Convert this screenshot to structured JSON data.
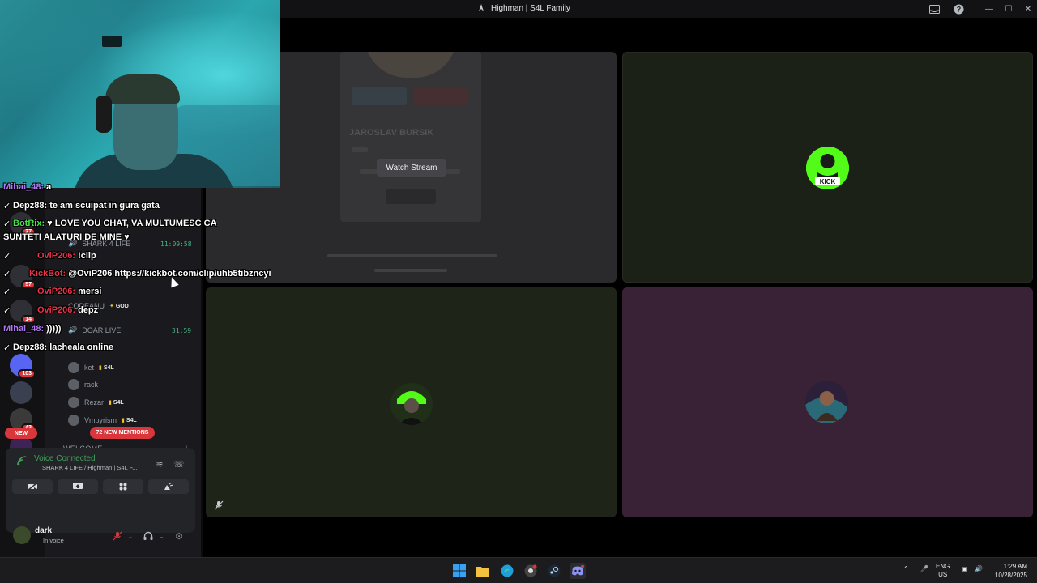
{
  "window": {
    "title": "Highman | S4L Family"
  },
  "stage": {
    "watch_stream": "Watch Stream"
  },
  "screenshare_ghost": {
    "name": "JAROSLAV BURSIK"
  },
  "sidebar": {
    "channels": [
      {
        "name": "SHARK 4 LIFE",
        "time": "11:09:58"
      },
      {
        "name": "DOAR LIVE",
        "time": "31:59"
      }
    ],
    "members": [
      {
        "name": "CODEANU",
        "tag": "GOD"
      },
      {
        "name": "ket",
        "tag": "S4L"
      },
      {
        "name": "rack",
        "tag": ""
      },
      {
        "name": "Rezar",
        "tag": "S4L"
      },
      {
        "name": "Vmpyrism",
        "tag": "S4L"
      }
    ],
    "section_header": "WELCOME",
    "server_badges": [
      "37",
      "57",
      "14",
      "103",
      "43"
    ],
    "new_label": "NEW",
    "mentions_label": "72 NEW MENTIONS"
  },
  "voice": {
    "status": "Voice Connected",
    "channel": "SHARK 4 LIFE / Highman | S4L F...",
    "user": "dark",
    "user_status": "In voice"
  },
  "chat": [
    {
      "user": "Mihai_48:",
      "text": "a",
      "color": "#b07af0"
    },
    {
      "user": "Depz88:",
      "text": "te am scuipat in gura gata",
      "color": "#ffffff"
    },
    {
      "user": "BotRix:",
      "text": "♥ LOVE YOU CHAT, VA MULTUMESC CA",
      "color": "#49e04c"
    },
    {
      "user": "",
      "text": "SUNTETI ALATURI DE MINE ♥",
      "color": "#ffffff"
    },
    {
      "user": "OviP206:",
      "text": "!clip",
      "color": "#e8344a"
    },
    {
      "user": "KickBot:",
      "text": "@OviP206 https://kickbot.com/clip/uhb5tibzncyi",
      "color": "#e8344a"
    },
    {
      "user": "OviP206:",
      "text": "mersi",
      "color": "#e8344a"
    },
    {
      "user": "OviP206:",
      "text": "depz",
      "color": "#e8344a"
    },
    {
      "user": "Mihai_48:",
      "text": ")))))",
      "color": "#b07af0"
    },
    {
      "user": "Depz88:",
      "text": "lacheala online",
      "color": "#ffffff"
    }
  ],
  "taskbar": {
    "lang_top": "ENG",
    "lang_bottom": "US",
    "time": "1:29 AM",
    "date": "10/28/2025"
  },
  "colors": {
    "accent_red": "#da373c",
    "voice_green": "#43a25a",
    "kick_green": "#53fc18"
  }
}
